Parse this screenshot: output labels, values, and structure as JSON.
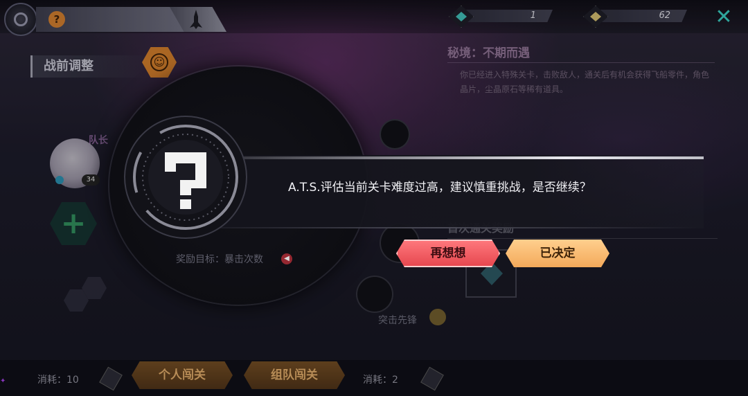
{
  "top_bar": {
    "currency_1": {
      "amount": "1",
      "gem_color": "#3fb7b0",
      "icon": "cyan-crystal-icon"
    },
    "currency_2": {
      "amount": "62",
      "gem_color": "#c9b46b",
      "icon": "gold-crystal-icon"
    },
    "close_icon": "close-icon"
  },
  "left_panel": {
    "title": "战前调整",
    "captain_label": "队长",
    "captain_level": "34",
    "reward_goal": "奖励目标：暴击次数"
  },
  "right_panel": {
    "secret_title": "秘境：不期而遇",
    "secret_desc": "你已经进入特殊关卡，击败敌人，通关后有机会获得飞船零件，角色晶片，尘晶原石等稀有道具。",
    "first_reward_title": "首次通关奖励"
  },
  "map": {
    "node_label": "突击先锋"
  },
  "bottom_bar": {
    "cost_left": "消耗：10",
    "cost_right": "消耗：2",
    "solo_button": "个人闯关",
    "team_button": "组队闯关"
  },
  "dialog": {
    "message": "A.T.S.评估当前关卡难度过高，建议慎重挑战，是否继续？",
    "reconsider_button": "再想想",
    "decided_button": "已决定",
    "icon": "question-mark-icon"
  },
  "colors": {
    "accent_teal": "#38c4b8",
    "button_red": "#f05a62",
    "button_orange": "#f8bb72",
    "mode_button": "#5e3e1d"
  }
}
